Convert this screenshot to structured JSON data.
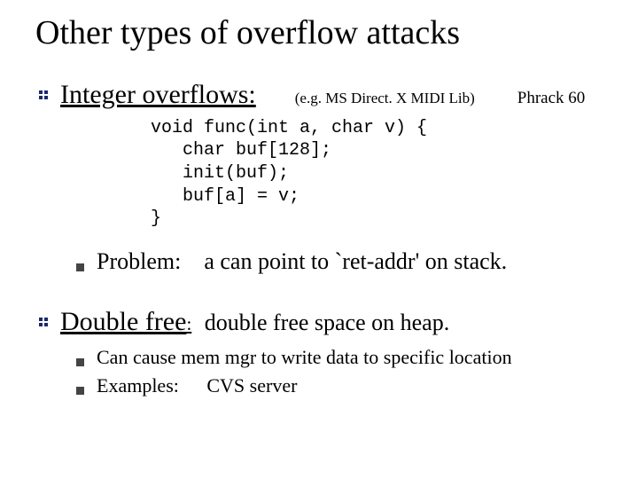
{
  "title": "Other types of overflow attacks",
  "sec1": {
    "heading": "Integer overflows:",
    "example_note": "(e.g.  MS Direct. X MIDI Lib)",
    "ref": "Phrack 60",
    "code": "void func(int a, char v) {\n   char buf[128];\n   init(buf);\n   buf[a] = v;\n}",
    "problem_label": "Problem:",
    "problem_text": "a  can point to `ret-addr'  on stack."
  },
  "sec2": {
    "heading": "Double free",
    "colon": ":",
    "rest": "double free space on heap.",
    "sub1": "Can cause mem mgr to write data to specific location",
    "examples_label": "Examples:",
    "examples_value": "CVS server"
  }
}
